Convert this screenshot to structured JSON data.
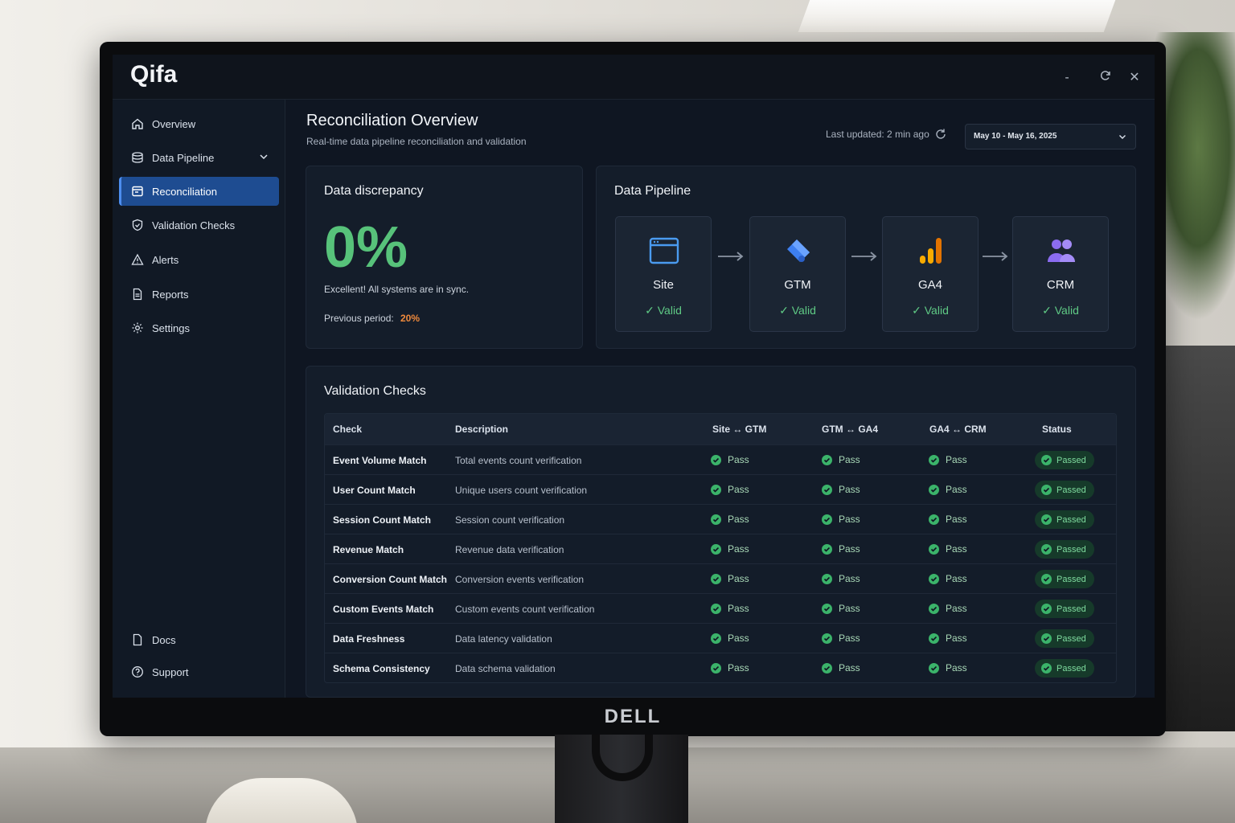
{
  "app": {
    "logo": "Qifa"
  },
  "window_controls": {
    "minimize": "-",
    "maximize": "⟳",
    "close": "✕"
  },
  "monitor": {
    "brand": "DELL"
  },
  "sidebar": {
    "items": [
      {
        "label": "Overview",
        "icon": "home-icon"
      },
      {
        "label": "Data Pipeline",
        "icon": "pipeline-icon",
        "expandable": true
      },
      {
        "label": "Reconciliation",
        "icon": "reconciliation-icon",
        "active": true
      },
      {
        "label": "Validation Checks",
        "icon": "shield-icon"
      },
      {
        "label": "Alerts",
        "icon": "alert-triangle-icon"
      },
      {
        "label": "Reports",
        "icon": "document-icon"
      },
      {
        "label": "Settings",
        "icon": "gear-icon"
      }
    ],
    "footer": [
      {
        "label": "Docs",
        "icon": "doc-icon"
      },
      {
        "label": "Support",
        "icon": "help-circle-icon"
      }
    ]
  },
  "header": {
    "title": "Reconciliation Overview",
    "subtitle": "Real-time data pipeline reconciliation and validation",
    "last_updated": "Last updated: 2 min ago",
    "date_range": "May 10 - May 16, 2025"
  },
  "discrepancy": {
    "title": "Data discrepancy",
    "value": "0%",
    "message": "Excellent! All systems are in sync.",
    "previous_label": "Previous period:",
    "previous_value": "20%"
  },
  "pipeline": {
    "title": "Data Pipeline",
    "nodes": [
      {
        "name": "Site",
        "status": "✓ Valid",
        "icon": "browser-window-icon"
      },
      {
        "name": "GTM",
        "status": "✓ Valid",
        "icon": "gtm-tag-icon"
      },
      {
        "name": "GA4",
        "status": "✓ Valid",
        "icon": "bar-chart-icon"
      },
      {
        "name": "CRM",
        "status": "✓ Valid",
        "icon": "users-icon"
      }
    ]
  },
  "validation": {
    "title": "Validation Checks",
    "columns": [
      "Check",
      "Description",
      "Site ↔ GTM",
      "GTM ↔ GA4",
      "GA4 ↔ CRM",
      "Status"
    ],
    "rows": [
      {
        "check": "Event Volume Match",
        "description": "Total events count verification",
        "site_gtm": "Pass",
        "gtm_ga4": "Pass",
        "ga4_crm": "Pass",
        "status": "Passed"
      },
      {
        "check": "User Count Match",
        "description": "Unique users count verification",
        "site_gtm": "Pass",
        "gtm_ga4": "Pass",
        "ga4_crm": "Pass",
        "status": "Passed"
      },
      {
        "check": "Session Count Match",
        "description": "Session count verification",
        "site_gtm": "Pass",
        "gtm_ga4": "Pass",
        "ga4_crm": "Pass",
        "status": "Passed"
      },
      {
        "check": "Revenue Match",
        "description": "Revenue data verification",
        "site_gtm": "Pass",
        "gtm_ga4": "Pass",
        "ga4_crm": "Pass",
        "status": "Passed"
      },
      {
        "check": "Conversion Count Match",
        "description": "Conversion events verification",
        "site_gtm": "Pass",
        "gtm_ga4": "Pass",
        "ga4_crm": "Pass",
        "status": "Passed"
      },
      {
        "check": "Custom Events Match",
        "description": "Custom events count verification",
        "site_gtm": "Pass",
        "gtm_ga4": "Pass",
        "ga4_crm": "Pass",
        "status": "Passed"
      },
      {
        "check": "Data Freshness",
        "description": "Data latency validation",
        "site_gtm": "Pass",
        "gtm_ga4": "Pass",
        "ga4_crm": "Pass",
        "status": "Passed"
      },
      {
        "check": "Schema Consistency",
        "description": "Data schema validation",
        "site_gtm": "Pass",
        "gtm_ga4": "Pass",
        "ga4_crm": "Pass",
        "status": "Passed"
      }
    ]
  },
  "colors": {
    "accent": "#1e4c91",
    "success": "#57c27a",
    "warning": "#f08a3c",
    "background": "#0f1622"
  }
}
